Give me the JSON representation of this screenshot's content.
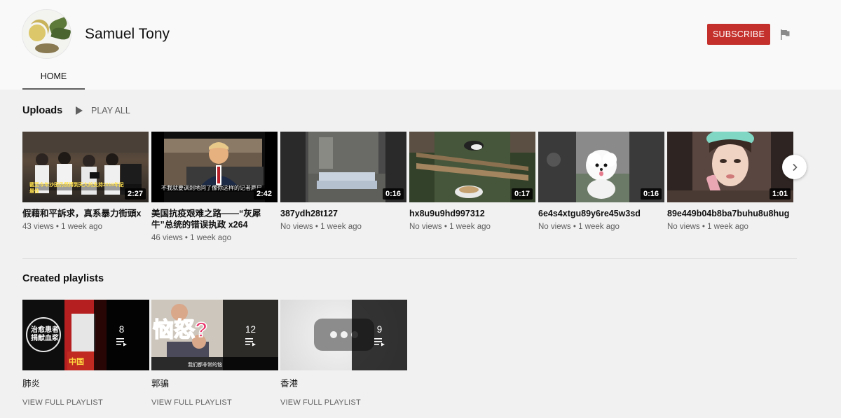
{
  "channel": {
    "name": "Samuel Tony",
    "subscribe_label": "SUBSCRIBE",
    "tabs": [
      {
        "label": "HOME",
        "active": true
      }
    ],
    "accent_color": "#c4302b"
  },
  "uploads": {
    "title": "Uploads",
    "play_all_label": "PLAY ALL",
    "videos": [
      {
        "title": "假藉和平訴求，真系暴力街頭x",
        "meta": "43 views • 1 week ago",
        "duration": "2:27",
        "thumb_text": "截至今年沙田仍然得到天大的支持2019年記最佳"
      },
      {
        "title": "美国抗疫艰难之路——“灰犀牛”总统的错误执政 x264",
        "meta": "46 views • 1 week ago",
        "duration": "2:42",
        "thumb_text": "不我就要讽刺地问了像你这样的记者两尸"
      },
      {
        "title": "387ydh28t127",
        "meta": "No views • 1 week ago",
        "duration": "0:16"
      },
      {
        "title": "hx8u9u9hd997312",
        "meta": "No views • 1 week ago",
        "duration": "0:17"
      },
      {
        "title": "6e4s4xtgu89y6re45w3sd",
        "meta": "No views • 1 week ago",
        "duration": "0:16"
      },
      {
        "title": "89e449b04b8ba7buhu8u8hug",
        "meta": "No views • 1 week ago",
        "duration": "1:01"
      }
    ]
  },
  "playlists": {
    "title": "Created playlists",
    "items": [
      {
        "title": "肺炎",
        "count": "8",
        "link": "VIEW FULL PLAYLIST",
        "thumb_text_a": "治愈患者捐献血浆",
        "thumb_text_b": "中国"
      },
      {
        "title": "郭骗",
        "count": "12",
        "link": "VIEW FULL PLAYLIST",
        "thumb_text_a": "恼怒?",
        "thumb_text_b": "我们都非常的恼"
      },
      {
        "title": "香港",
        "count": "9",
        "link": "VIEW FULL PLAYLIST"
      }
    ]
  },
  "icons": {
    "flag": "flag-icon",
    "play": "play-icon",
    "next": "chevron-right-icon",
    "playlist": "playlist-icon"
  }
}
